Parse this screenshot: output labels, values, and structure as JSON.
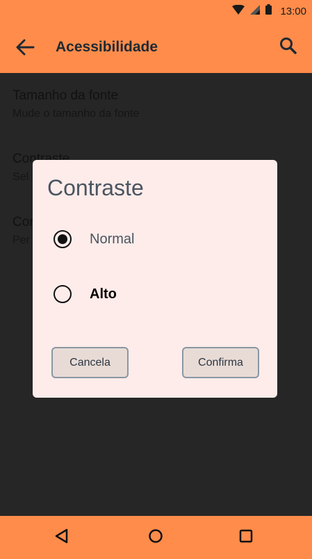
{
  "status_bar": {
    "time": "13:00",
    "icons": [
      "wifi-icon",
      "signal-icon",
      "battery-icon"
    ]
  },
  "app_bar": {
    "title": "Acessibilidade",
    "back_icon": "arrow-back-icon",
    "search_icon": "search-icon"
  },
  "settings": [
    {
      "title": "Tamanho da fonte",
      "subtitle": "Mude o tamanho da fonte"
    },
    {
      "title": "Contraste",
      "subtitle": "Sel"
    },
    {
      "title": "Cor",
      "subtitle": "Per"
    }
  ],
  "dialog": {
    "title": "Contraste",
    "options": [
      {
        "label": "Normal",
        "selected": true
      },
      {
        "label": "Alto",
        "selected": false
      }
    ],
    "cancel_label": "Cancela",
    "confirm_label": "Confirma"
  },
  "nav_bar": {
    "icons": [
      "back-triangle-icon",
      "home-circle-icon",
      "recents-square-icon"
    ]
  },
  "colors": {
    "accent": "#ff8c4b",
    "background": "#262626",
    "dialog_bg": "#fdecea",
    "button_bg": "#e8dbd6",
    "title_text": "#4a5560"
  }
}
